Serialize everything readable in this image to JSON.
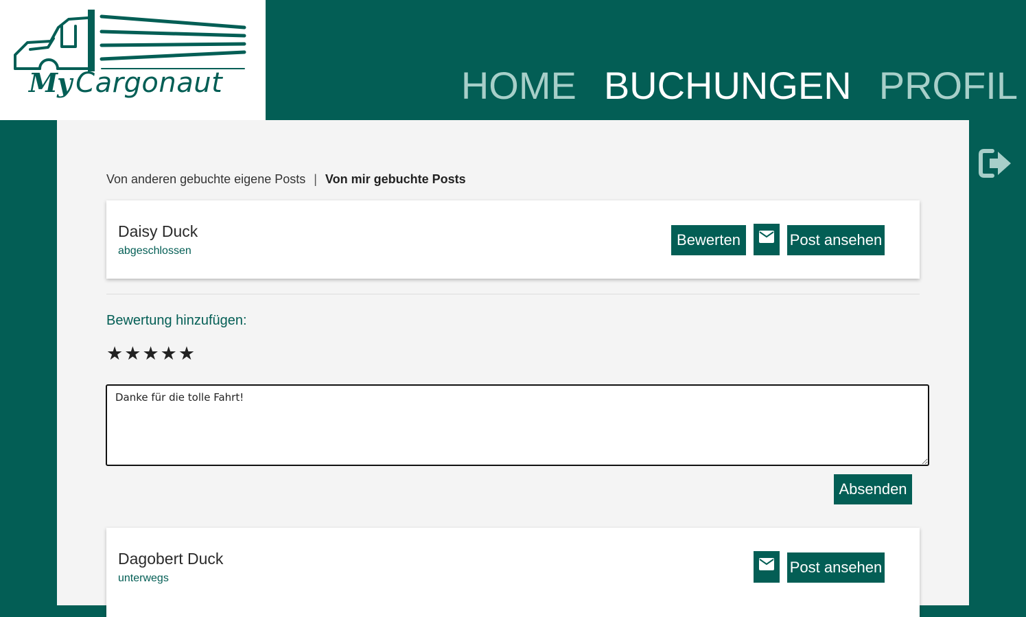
{
  "logo": {
    "my": "My",
    "cargonaut": "Cargonaut"
  },
  "nav": [
    {
      "label": "HOME",
      "active": false
    },
    {
      "label": "BUCHUNGEN",
      "active": true
    },
    {
      "label": "PROFIL",
      "active": false
    }
  ],
  "logout_icon": "logout-icon",
  "tabs": {
    "others": "Von anderen gebuchte eigene Posts",
    "separator": "|",
    "mine": "Von mir gebuchte Posts",
    "active": "mine"
  },
  "bookings": [
    {
      "name": "Daisy Duck",
      "status": "abgeschlossen",
      "rate_label": "Bewerten",
      "view_label": "Post ansehen"
    },
    {
      "name": "Dagobert Duck",
      "status": "unterwegs",
      "view_label": "Post ansehen"
    }
  ],
  "rating": {
    "title": "Bewertung hinzufügen:",
    "stars": [
      "★",
      "★",
      "★",
      "★",
      "★"
    ],
    "comment": "Danke für die tolle Fahrt!",
    "submit_label": "Absenden"
  },
  "colors": {
    "primary": "#035e55",
    "nav_inactive": "#a7cfc9",
    "panel": "#f4f4f4"
  }
}
